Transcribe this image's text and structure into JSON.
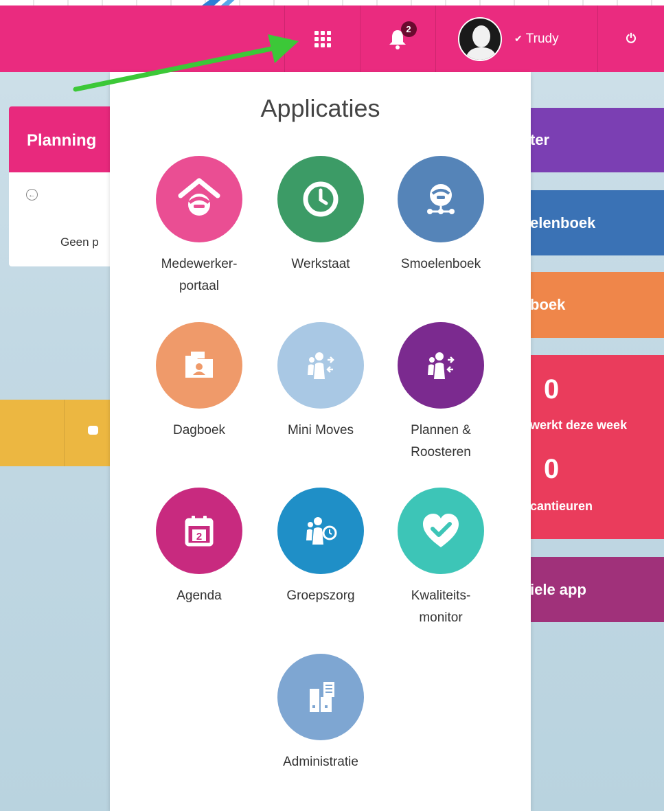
{
  "header": {
    "notification_count": "2",
    "user_name": "Trudy"
  },
  "background": {
    "planning_title": "Planning",
    "planning_text": "Geen p",
    "right_cards": [
      "ter",
      "elenboek",
      "boek"
    ],
    "stat1_value": "0",
    "stat1_label": "werkt deze week",
    "stat2_value": "0",
    "stat2_label": "cantieuren",
    "mobile_app": "iele app"
  },
  "apps_menu": {
    "title": "Applicaties",
    "items": [
      {
        "label": "Medewerker-\nportaal",
        "icon": "home-person-icon",
        "color": "#ea4e93"
      },
      {
        "label": "Werkstaat",
        "icon": "clock-icon",
        "color": "#3c9b66"
      },
      {
        "label": "Smoelenboek",
        "icon": "person-network-icon",
        "color": "#5584b8"
      },
      {
        "label": "Dagboek",
        "icon": "folder-person-icon",
        "color": "#ef9a6a"
      },
      {
        "label": "Mini Moves",
        "icon": "people-arrows-icon",
        "color": "#a9c8e4"
      },
      {
        "label": "Plannen &\nRoosteren",
        "icon": "people-arrows-icon",
        "color": "#7b2a8f"
      },
      {
        "label": "Agenda",
        "icon": "calendar-icon",
        "color": "#c82a7f"
      },
      {
        "label": "Groepszorg",
        "icon": "people-clock-icon",
        "color": "#1f8fc7"
      },
      {
        "label": "Kwaliteits-\nmonitor",
        "icon": "heart-check-icon",
        "color": "#3dc5b7"
      },
      {
        "label": "Administratie",
        "icon": "cabinet-list-icon",
        "color": "#7ea6d2"
      }
    ],
    "calendar_day": "2"
  },
  "colors": {
    "header": "#ea2b7f",
    "arrow": "#3cc838"
  }
}
